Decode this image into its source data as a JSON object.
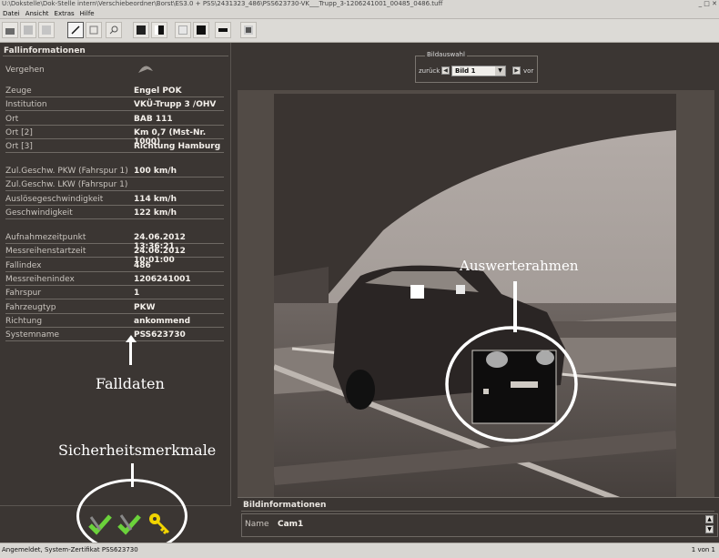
{
  "window": {
    "title": "U:\\Dokstelle\\Dok-Stelle intern\\Verschiebeordner\\Borst\\ES3.0 + PSS\\2431323_486\\PSS623730-VK___Trupp_3-1206241001_00485_0486.tuff"
  },
  "menu": [
    "Datei",
    "Ansicht",
    "Extras",
    "Hilfe"
  ],
  "left_panel": {
    "title": "Fallinformationen",
    "vergehen_label": "Vergehen",
    "rows_a": [
      {
        "label": "Zeuge",
        "value": "Engel POK"
      },
      {
        "label": "Institution",
        "value": "VKÜ-Trupp 3 /OHV"
      },
      {
        "label": "Ort",
        "value": "BAB 111"
      },
      {
        "label": "Ort [2]",
        "value": "Km 0,7 (Mst-Nr. 1000)"
      },
      {
        "label": "Ort [3]",
        "value": "Richtung Hamburg"
      }
    ],
    "rows_b": [
      {
        "label": "Zul.Geschw. PKW (Fahrspur 1)",
        "value": "100 km/h"
      },
      {
        "label": "Zul.Geschw. LKW (Fahrspur 1)",
        "value": ""
      },
      {
        "label": "Auslösegeschwindigkeit",
        "value": "114 km/h"
      },
      {
        "label": "Geschwindigkeit",
        "value": "122 km/h"
      }
    ],
    "rows_c": [
      {
        "label": "Aufnahmezeitpunkt",
        "value": "24.06.2012 13:36:21"
      },
      {
        "label": "Messreihenstartzeit",
        "value": "24.06.2012 10:01:00"
      },
      {
        "label": "Fallindex",
        "value": "486"
      },
      {
        "label": "Messreihenindex",
        "value": "1206241001"
      },
      {
        "label": "Fahrspur",
        "value": "1"
      },
      {
        "label": "Fahrzeugtyp",
        "value": "PKW"
      },
      {
        "label": "Richtung",
        "value": "ankommend"
      },
      {
        "label": "Systemname",
        "value": "PSS623730"
      }
    ]
  },
  "annotations": {
    "falldaten": "Falldaten",
    "sicherheitsmerkmale": "Sicherheitsmerkmale",
    "auswerterahmen": "Auswerterahmen"
  },
  "bildauswahl": {
    "title": "Bildauswahl",
    "prev_label": "zurück",
    "next_label": "vor",
    "selected": "Bild 1"
  },
  "bildinfo": {
    "title": "Bildinformationen",
    "name_label": "Name",
    "name_value": "Cam1"
  },
  "status": {
    "left": "Angemeldet, System-Zertifikat PSS623730",
    "right": "1 von 1"
  }
}
